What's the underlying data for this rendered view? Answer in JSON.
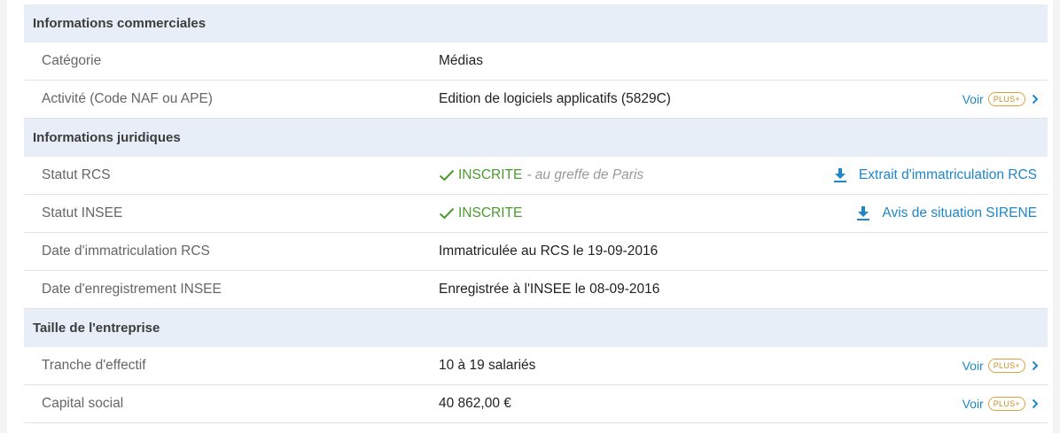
{
  "sections": [
    {
      "title": "Informations commerciales",
      "rows": [
        {
          "label": "Catégorie",
          "value": "Médias"
        },
        {
          "label": "Activité (Code NAF ou APE)",
          "value": "Edition de logiciels applicatifs (5829C)",
          "link": "Voir",
          "badge": "PLUS+"
        }
      ]
    },
    {
      "title": "Informations juridiques",
      "rows": [
        {
          "label": "Statut RCS",
          "status": "INSCRITE",
          "note": "- au greffe de Paris",
          "action": "Extrait d'immatriculation RCS"
        },
        {
          "label": "Statut INSEE",
          "status": "INSCRITE",
          "action": "Avis de situation SIRENE"
        },
        {
          "label": "Date d'immatriculation RCS",
          "value": "Immatriculée au RCS le 19-09-2016"
        },
        {
          "label": "Date d'enregistrement INSEE",
          "value": "Enregistrée à l'INSEE le 08-09-2016"
        }
      ]
    },
    {
      "title": "Taille de l'entreprise",
      "rows": [
        {
          "label": "Tranche d'effectif",
          "value": "10 à 19 salariés",
          "link": "Voir",
          "badge": "PLUS+"
        },
        {
          "label": "Capital social",
          "value": "40 862,00 €",
          "link": "Voir",
          "badge": "PLUS+"
        }
      ]
    }
  ],
  "icons": {
    "check": "check-icon",
    "download": "download-icon",
    "chevron": "chevron-right-icon"
  },
  "colors": {
    "header_bg": "#e8eef7",
    "link": "#1e88c7",
    "success": "#4b9a30",
    "badge": "#c89125"
  }
}
